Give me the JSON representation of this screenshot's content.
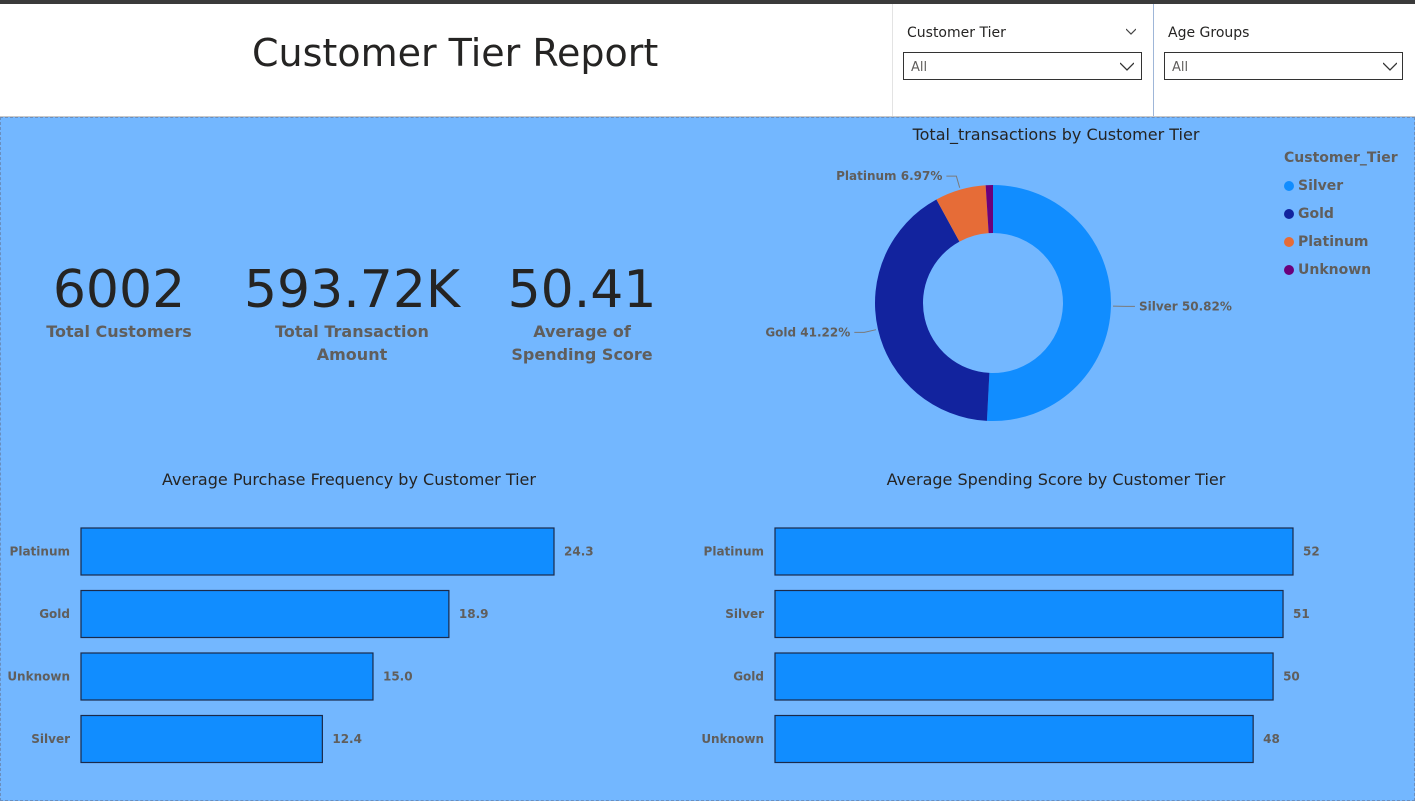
{
  "header": {
    "title": "Customer Tier Report"
  },
  "slicers": [
    {
      "label": "Customer Tier",
      "value": "All"
    },
    {
      "label": "Age Groups",
      "value": "All"
    }
  ],
  "kpis": [
    {
      "value": "6002",
      "label": "Total Customers"
    },
    {
      "value": "593.72K",
      "label": "Total Transaction Amount"
    },
    {
      "value": "50.41",
      "label": "Average of Spending Score"
    }
  ],
  "colors": {
    "canvas": "#73b7ff",
    "silver": "#118dff",
    "gold": "#12239e",
    "platinum": "#e66c37",
    "unknown": "#6b007b",
    "bar": "#118dff"
  },
  "chart_data": [
    {
      "type": "pie",
      "title": "Total_transactions by Customer Tier",
      "legend_title": "Customer_Tier",
      "legend_position": "top-right",
      "slices": [
        {
          "name": "Silver",
          "value": 50.82,
          "label": "Silver 50.82%",
          "color": "#118dff"
        },
        {
          "name": "Gold",
          "value": 41.22,
          "label": "Gold 41.22%",
          "color": "#12239e"
        },
        {
          "name": "Platinum",
          "value": 6.97,
          "label": "Platinum 6.97%",
          "color": "#e66c37"
        },
        {
          "name": "Unknown",
          "value": 0.99,
          "label": "",
          "color": "#6b007b"
        }
      ]
    },
    {
      "type": "bar",
      "title": "Average Purchase Frequency by Customer Tier",
      "categories": [
        "Platinum",
        "Gold",
        "Unknown",
        "Silver"
      ],
      "values": [
        24.3,
        18.9,
        15.0,
        12.4
      ],
      "labels": [
        "24.3",
        "18.9",
        "15.0",
        "12.4"
      ],
      "xlim": [
        0,
        24.3
      ]
    },
    {
      "type": "bar",
      "title": "Average Spending Score by Customer Tier",
      "categories": [
        "Platinum",
        "Silver",
        "Gold",
        "Unknown"
      ],
      "values": [
        52,
        51,
        50,
        48
      ],
      "labels": [
        "52",
        "51",
        "50",
        "48"
      ],
      "xlim": [
        0,
        52
      ]
    }
  ]
}
